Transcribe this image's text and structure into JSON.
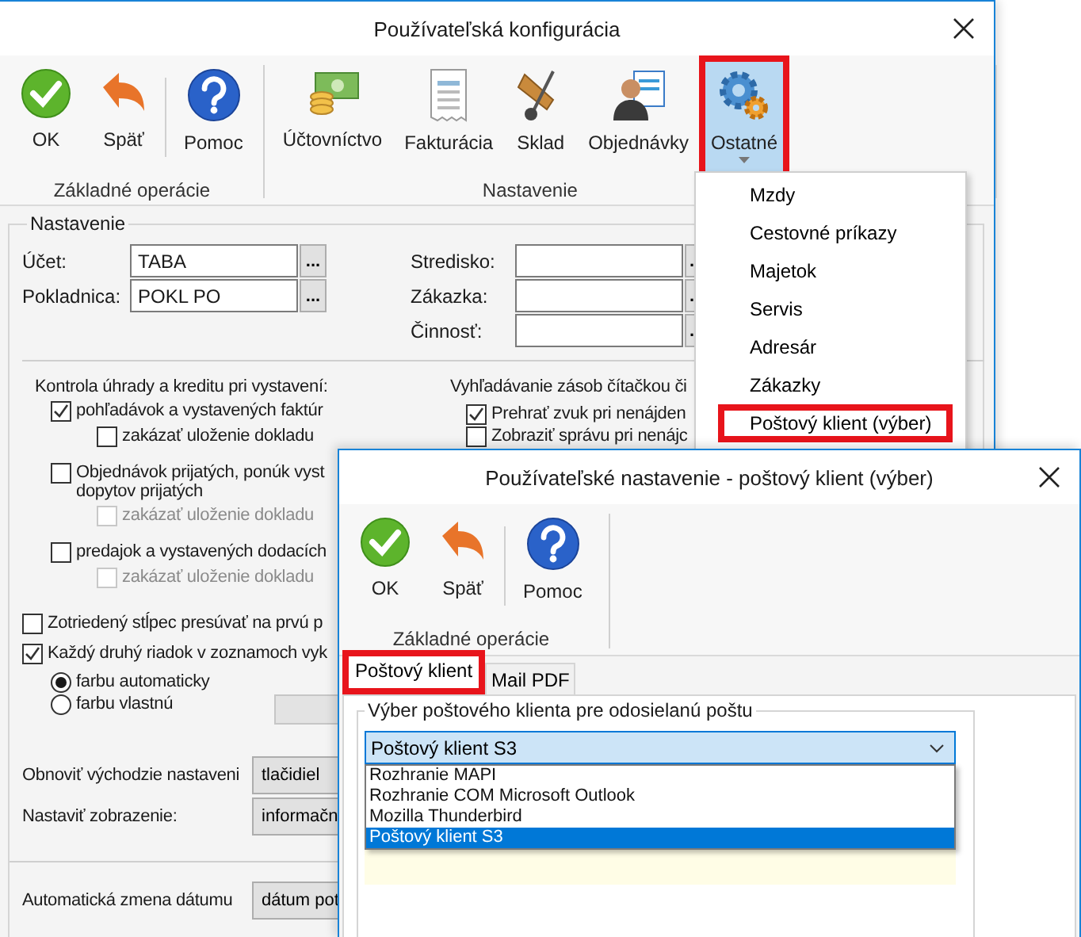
{
  "main_window": {
    "title": "Používateľská konfigurácia",
    "toolbar": [
      {
        "label": "Základné operácie",
        "buttons": [
          {
            "kind": "ok",
            "label": "OK",
            "highlighted": false,
            "dropdown": false
          },
          {
            "kind": "back",
            "label": "Späť",
            "highlighted": false,
            "dropdown": false
          },
          {
            "kind": "help",
            "label": "Pomoc",
            "highlighted": false,
            "dropdown": false
          }
        ]
      },
      {
        "label": "Nastavenie",
        "buttons": [
          {
            "kind": "money",
            "label": "Účtovníctvo",
            "highlighted": false,
            "dropdown": false
          },
          {
            "kind": "invoice",
            "label": "Fakturácia",
            "highlighted": false,
            "dropdown": false
          },
          {
            "kind": "truck",
            "label": "Sklad",
            "highlighted": false,
            "dropdown": false
          },
          {
            "kind": "person",
            "label": "Objednávky",
            "highlighted": false,
            "dropdown": false
          },
          {
            "kind": "gears",
            "label": "Ostatné",
            "highlighted": true,
            "dropdown": true
          }
        ]
      }
    ],
    "settings": {
      "label": "Nastavenie",
      "fields_left": [
        {
          "label": "Účet:",
          "value": "TABA",
          "browse": "..."
        },
        {
          "label": "Pokladnica:",
          "value": "POKL PO",
          "browse": "..."
        }
      ],
      "fields_right": [
        {
          "label": "Stredisko:",
          "browse": "."
        },
        {
          "label": "Zákazka:",
          "browse": "."
        },
        {
          "label": "Činnosť:",
          "browse": "."
        }
      ],
      "payment_check": {
        "label": "Kontrola úhrady a kreditu pri vystavení:",
        "options": [
          {
            "label": "pohľadávok a vystavených faktúr",
            "checked": true,
            "disabled": false,
            "children": [
              {
                "label": "zakázať uloženie dokladu",
                "checked": false,
                "disabled": false
              }
            ]
          },
          {
            "label": "Objednávok prijatých, ponúk vyst",
            "second_line": "dopytov prijatých",
            "checked": false,
            "disabled": false,
            "children": [
              {
                "label": "zakázať uloženie dokladu",
                "checked": false,
                "disabled": true
              }
            ]
          },
          {
            "label": "predajok a vystavených dodacích",
            "checked": false,
            "disabled": false,
            "children": [
              {
                "label": "zakázať uloženie dokladu",
                "checked": false,
                "disabled": true
              }
            ]
          }
        ]
      },
      "scanner": {
        "label": "Vyhľadávanie zásob čítačkou či",
        "options": [
          {
            "label": "Prehrať zvuk pri nenájden",
            "checked": true
          },
          {
            "label": "Zobraziť správu pri nenájc",
            "checked": false
          }
        ]
      },
      "display_options": [
        {
          "label": "Zotriedený stĺpec presúvať na prvú p",
          "checked": false
        },
        {
          "label": "Každý druhý riadok v zoznamoch vyk",
          "checked": true
        }
      ],
      "color_modes": [
        {
          "label": "farbu automaticky",
          "selected": true
        },
        {
          "label": "farbu vlastnú",
          "selected": false
        }
      ],
      "color_picker": {
        "disabled": true
      },
      "actions": [
        {
          "label": "Obnoviť východzie nastaveni",
          "button": "tlačidiel"
        },
        {
          "label": "Nastaviť zobrazenie:",
          "button": "informačn"
        }
      ],
      "date_action": {
        "label": "Automatická zmena dátumu",
        "button": "dátum pot"
      }
    }
  },
  "menu": {
    "items": [
      {
        "label": "Mzdy",
        "highlighted": false
      },
      {
        "label": "Cestovné príkazy",
        "highlighted": false
      },
      {
        "label": "Majetok",
        "highlighted": false
      },
      {
        "label": "Servis",
        "highlighted": false
      },
      {
        "label": "Adresár",
        "highlighted": false
      },
      {
        "label": "Zákazky",
        "highlighted": false
      },
      {
        "label": "Poštový klient (výber)",
        "highlighted": true
      }
    ]
  },
  "dialog": {
    "title": "Používateľské nastavenie - poštový klient (výber)",
    "toolbar": {
      "label": "Základné operácie",
      "buttons": [
        {
          "kind": "ok",
          "label": "OK"
        },
        {
          "kind": "back",
          "label": "Späť"
        },
        {
          "kind": "help",
          "label": "Pomoc"
        }
      ]
    },
    "tabs": [
      {
        "label": "Poštový klient",
        "selected": true,
        "highlighted": true
      },
      {
        "label": "Mail PDF",
        "selected": false,
        "highlighted": false
      }
    ],
    "group_label": "Výber poštového klienta pre odosielanú poštu",
    "combo": {
      "value": "Poštový klient S3",
      "expanded": true,
      "options": [
        {
          "label": "Rozhranie MAPI",
          "selected": false
        },
        {
          "label": "Rozhranie COM Microsoft Outlook",
          "selected": false
        },
        {
          "label": "Mozilla Thunderbird",
          "selected": false
        },
        {
          "label": "Poštový klient S3",
          "selected": true
        }
      ]
    }
  }
}
